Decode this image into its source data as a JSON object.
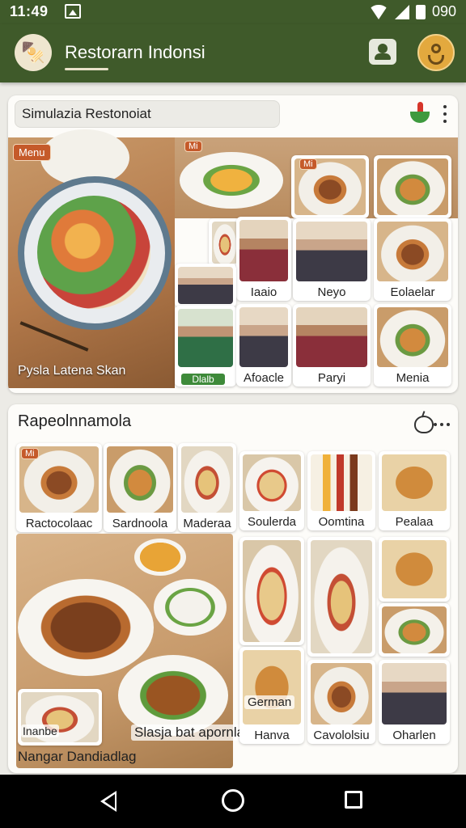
{
  "status_bar": {
    "time": "11:49",
    "battery_text": "090"
  },
  "app_bar": {
    "title": "Restorarn Indonsi"
  },
  "search": {
    "value": "Simulazia Restonoiat"
  },
  "menu_section": {
    "menu_badge": "Menu",
    "hero_caption": "Pysla Latena Skan",
    "small_badge_1": "Mi",
    "small_badge_2": "Mi",
    "tile_labels": [
      "Iaaio",
      "Neyo",
      "Eolaelar",
      "Afoacle",
      "Paryi",
      "Menia"
    ],
    "person_tile_caption": "Dlalb"
  },
  "recommendation_section": {
    "title": "Rapeolnnamola",
    "corner_badge": "Mi",
    "top_labels": [
      "Ractocolaac",
      "Sardnoola",
      "Maderaa",
      "Soulerda",
      "Oomtina",
      "Pealaa"
    ],
    "bottom_labels": [
      "Inanbe",
      "Slasja bat apornla",
      "Hanva",
      "Cavololsiu",
      "Oharlen"
    ],
    "german_label": "German",
    "footer_caption": "Nangar Dandiadlag"
  },
  "colors": {
    "brand_green": "#3f5a2a",
    "accent_orange": "#c55a2a",
    "avatar_gold": "#e3a93e"
  },
  "icons": [
    "image-icon",
    "wifi-icon",
    "signal-icon",
    "battery-icon",
    "logo-icon",
    "profile-icon",
    "avatar-icon",
    "filter-icon",
    "more-icon",
    "bowl-icon",
    "back-icon",
    "home-icon",
    "recent-apps-icon"
  ]
}
